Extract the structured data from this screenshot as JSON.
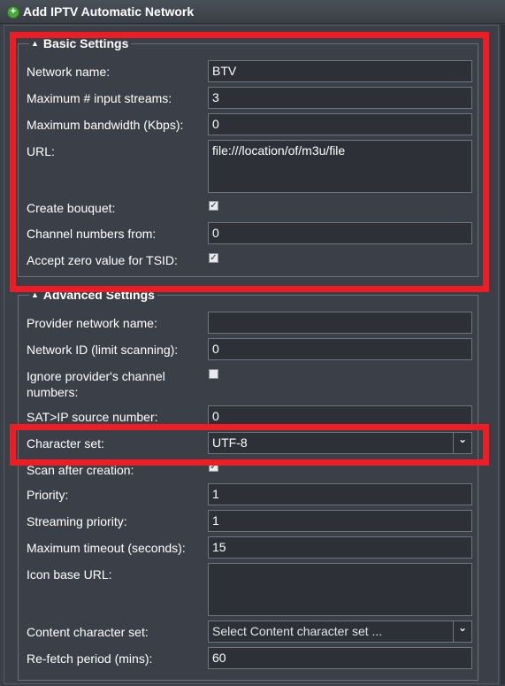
{
  "window": {
    "title": "Add IPTV Automatic Network",
    "title_icon": "add-circle-icon"
  },
  "basic": {
    "legend": "Basic Settings",
    "network_name_label": "Network name:",
    "network_name_value": "BTV",
    "max_streams_label": "Maximum # input streams:",
    "max_streams_value": "3",
    "max_bandwidth_label": "Maximum bandwidth (Kbps):",
    "max_bandwidth_value": "0",
    "url_label": "URL:",
    "url_value": "file:///location/of/m3u/file",
    "create_bouquet_label": "Create bouquet:",
    "create_bouquet_checked": true,
    "channel_numbers_label": "Channel numbers from:",
    "channel_numbers_value": "0",
    "accept_zero_tsid_label": "Accept zero value for TSID:",
    "accept_zero_tsid_checked": true
  },
  "advanced": {
    "legend": "Advanced Settings",
    "provider_network_label": "Provider network name:",
    "provider_network_value": "",
    "network_id_label": "Network ID (limit scanning):",
    "network_id_value": "0",
    "ignore_channel_numbers_label": "Ignore provider's channel numbers:",
    "ignore_channel_numbers_checked": false,
    "satip_label": "SAT>IP source number:",
    "satip_value": "0",
    "charset_label": "Character set:",
    "charset_value": "UTF-8",
    "scan_after_label": "Scan after creation:",
    "scan_after_checked": true,
    "priority_label": "Priority:",
    "priority_value": "1",
    "streaming_priority_label": "Streaming priority:",
    "streaming_priority_value": "1",
    "max_timeout_label": "Maximum timeout (seconds):",
    "max_timeout_value": "15",
    "icon_base_label": "Icon base URL:",
    "icon_base_value": "",
    "content_charset_label": "Content character set:",
    "content_charset_value": "Select Content character set ...",
    "refetch_label": "Re-fetch period (mins):",
    "refetch_value": "60"
  },
  "colors": {
    "highlight": "#ee1c24",
    "background": "#3b4048",
    "field_background": "#2d3137"
  }
}
